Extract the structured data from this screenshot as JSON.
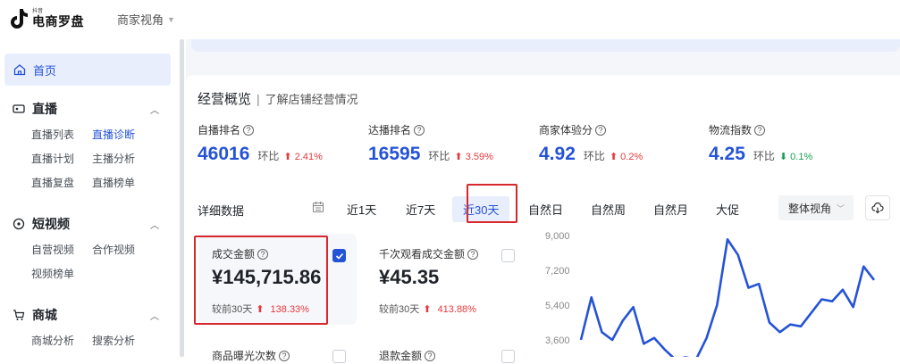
{
  "app": {
    "logo_small": "抖音",
    "logo_big": "电商罗盘",
    "view_switch": "商家视角"
  },
  "sidebar": {
    "home": "首页",
    "sections": [
      {
        "title": "直播",
        "icon": "live-icon",
        "items": [
          "直播列表",
          "直播诊断",
          "直播计划",
          "主播分析",
          "直播复盘",
          "直播榜单"
        ],
        "active": "直播诊断"
      },
      {
        "title": "短视频",
        "icon": "video-icon",
        "items": [
          "自营视频",
          "合作视频",
          "视频榜单"
        ]
      },
      {
        "title": "商城",
        "icon": "mall-icon",
        "items": [
          "商城分析",
          "搜索分析"
        ]
      }
    ]
  },
  "overview": {
    "title": "经营概览",
    "sep": "|",
    "subtitle": "了解店铺经营情况",
    "ratio_label": "环比",
    "metrics": [
      {
        "label": "自播排名",
        "value": "46016",
        "ratio": "2.41%",
        "dir": "up"
      },
      {
        "label": "达播排名",
        "value": "16595",
        "ratio": "3.59%",
        "dir": "up"
      },
      {
        "label": "商家体验分",
        "value": "4.92",
        "ratio": "0.2%",
        "dir": "up"
      },
      {
        "label": "物流指数",
        "value": "4.25",
        "ratio": "0.1%",
        "dir": "down"
      }
    ]
  },
  "detail": {
    "label": "详细数据",
    "ranges": [
      "近1天",
      "近7天",
      "近30天",
      "自然日",
      "自然周",
      "自然月",
      "大促"
    ],
    "active_range": "近30天",
    "view_dropdown": "整体视角",
    "kpis": [
      {
        "label": "成交金额",
        "value": "¥145,715.86",
        "compare": "较前30天",
        "ratio": "138.33%",
        "checked": true
      },
      {
        "label": "千次观看成交金额",
        "value": "¥45.35",
        "compare": "较前30天",
        "ratio": "413.88%",
        "checked": false
      },
      {
        "label": "商品曝光次数",
        "checked": false
      },
      {
        "label": "退款金额",
        "checked": false
      }
    ]
  },
  "chart_data": {
    "type": "line",
    "title": "",
    "xlabel": "",
    "ylabel": "",
    "y_ticks": [
      "9,000",
      "7,200",
      "5,400",
      "3,600"
    ],
    "ylim": [
      1800,
      9000
    ],
    "grid": false,
    "series": [
      {
        "color": "#2553d6",
        "values": [
          3600,
          5800,
          4000,
          3600,
          4600,
          5300,
          3400,
          3700,
          3100,
          2600,
          2700,
          2600,
          3700,
          5400,
          8800,
          8000,
          6300,
          6500,
          4500,
          4000,
          4400,
          4300,
          5000,
          5700,
          5600,
          6200,
          5300,
          7400,
          6700
        ]
      }
    ]
  },
  "colors": {
    "accent": "#2553d6",
    "up": "#e8383d",
    "down": "#1a9e55",
    "highlight_box": "#d7262c"
  }
}
